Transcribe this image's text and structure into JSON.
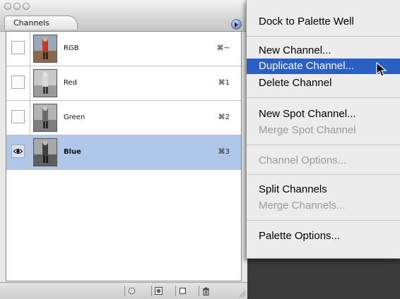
{
  "window": {
    "buttons": [
      "close",
      "minimize",
      "zoom"
    ]
  },
  "palette": {
    "tab_label": "Channels",
    "menu_button_icon": "flyout-arrow-icon",
    "channels": [
      {
        "name": "RGB",
        "shortcut": "⌘~",
        "visible": false,
        "selected": false
      },
      {
        "name": "Red",
        "shortcut": "⌘1",
        "visible": false,
        "selected": false
      },
      {
        "name": "Green",
        "shortcut": "⌘2",
        "visible": false,
        "selected": false
      },
      {
        "name": "Blue",
        "shortcut": "⌘3",
        "visible": true,
        "selected": true
      }
    ],
    "bottom_buttons": [
      {
        "icon": "load-selection-icon"
      },
      {
        "icon": "save-selection-icon"
      },
      {
        "icon": "new-channel-icon"
      },
      {
        "icon": "trash-icon"
      }
    ]
  },
  "menu": {
    "items": [
      {
        "label": "Dock to Palette Well",
        "enabled": true
      },
      {
        "label": "New Channel...",
        "enabled": true
      },
      {
        "label": "Duplicate Channel...",
        "enabled": true,
        "highlighted": true
      },
      {
        "label": "Delete Channel",
        "enabled": true
      },
      {
        "label": "New Spot Channel...",
        "enabled": true
      },
      {
        "label": "Merge Spot Channel",
        "enabled": false
      },
      {
        "label": "Channel Options...",
        "enabled": false
      },
      {
        "label": "Split Channels",
        "enabled": true
      },
      {
        "label": "Merge Channels...",
        "enabled": false
      },
      {
        "label": "Palette Options...",
        "enabled": true
      }
    ]
  },
  "colors": {
    "selected_row": "#afc8ea",
    "menu_highlight": "#2a5fc3",
    "disabled_text": "#9a9a9a"
  }
}
